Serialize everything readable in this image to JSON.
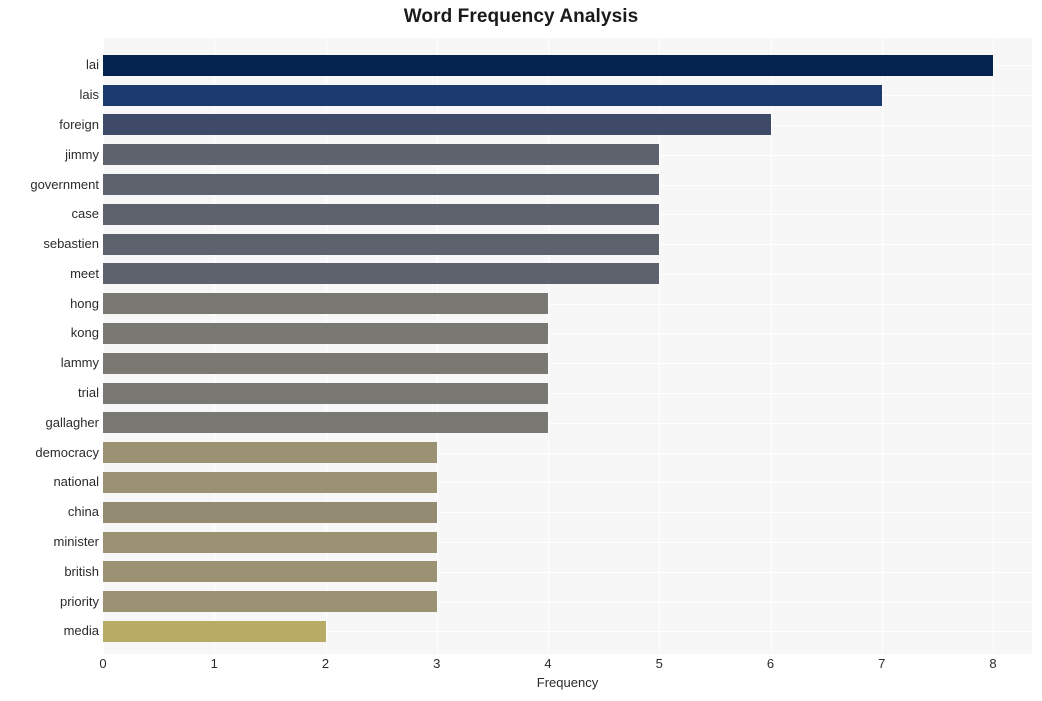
{
  "chart_data": {
    "type": "bar",
    "orientation": "horizontal",
    "title": "Word Frequency Analysis",
    "xlabel": "Frequency",
    "ylabel": "",
    "xlim": [
      0,
      8.35
    ],
    "xticks": [
      0,
      1,
      2,
      3,
      4,
      5,
      6,
      7,
      8
    ],
    "xtick_labels": [
      "0",
      "1",
      "2",
      "3",
      "4",
      "5",
      "6",
      "7",
      "8"
    ],
    "grid": true,
    "grid_axis": "both",
    "legend": null,
    "categories": [
      "lai",
      "lais",
      "foreign",
      "jimmy",
      "government",
      "case",
      "sebastien",
      "meet",
      "hong",
      "kong",
      "lammy",
      "trial",
      "gallagher",
      "democracy",
      "national",
      "china",
      "minister",
      "british",
      "priority",
      "media"
    ],
    "values": [
      8,
      7,
      6,
      5,
      5,
      5,
      5,
      5,
      4,
      4,
      4,
      4,
      4,
      3,
      3,
      3,
      3,
      3,
      3,
      2
    ],
    "bar_colors": [
      "#04234f",
      "#1c3a70",
      "#3f4a68",
      "#5d626d",
      "#5d626d",
      "#5d626d",
      "#5d626d",
      "#5d626d",
      "#7a7872",
      "#7a7872",
      "#7a7872",
      "#7a7872",
      "#7a7872",
      "#9b9273",
      "#9b9273",
      "#938c72",
      "#9b9273",
      "#9b9273",
      "#9b9273",
      "#b8ab65"
    ],
    "plot_background": "#f7f7f7",
    "grid_color": "#ffffff",
    "figure_background": "#ffffff"
  }
}
